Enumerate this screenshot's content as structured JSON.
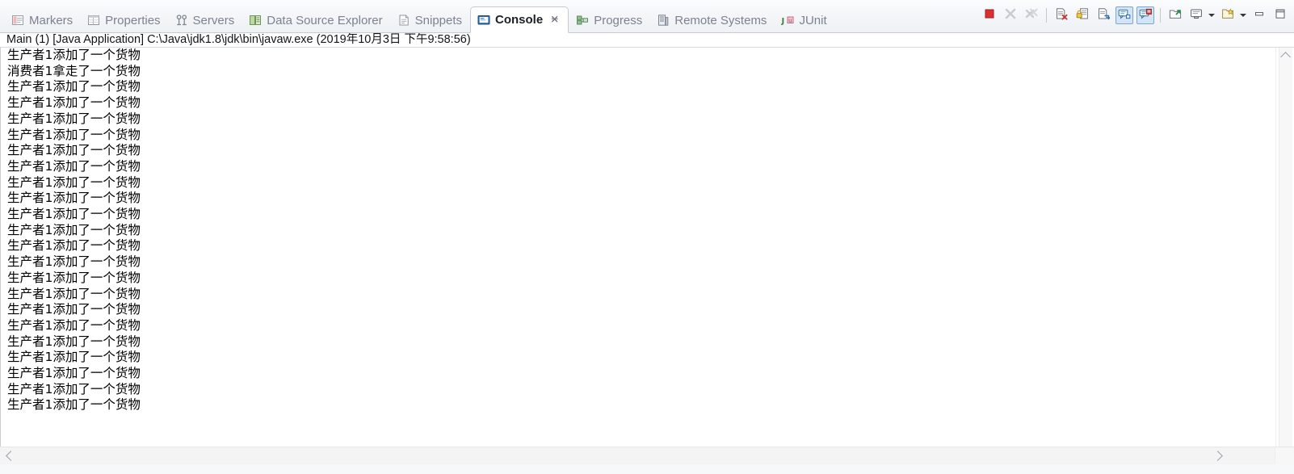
{
  "view": {
    "active_tab": "Console",
    "accent_color": "#d3e4f5",
    "toggled_border_color": "#7da7d0"
  },
  "tabs": [
    {
      "label": "Markers",
      "icon": "markers-icon",
      "active": false,
      "closable": false
    },
    {
      "label": "Properties",
      "icon": "properties-icon",
      "active": false,
      "closable": false
    },
    {
      "label": "Servers",
      "icon": "servers-icon",
      "active": false,
      "closable": false
    },
    {
      "label": "Data Source Explorer",
      "icon": "data-source-explorer-icon",
      "active": false,
      "closable": false
    },
    {
      "label": "Snippets",
      "icon": "snippets-icon",
      "active": false,
      "closable": false
    },
    {
      "label": "Console",
      "icon": "console-icon",
      "active": true,
      "closable": true
    },
    {
      "label": "Progress",
      "icon": "progress-icon",
      "active": false,
      "closable": false
    },
    {
      "label": "Remote Systems",
      "icon": "remote-systems-icon",
      "active": false,
      "closable": false
    },
    {
      "label": "JUnit",
      "icon": "junit-icon",
      "active": false,
      "closable": false
    }
  ],
  "toolbar": {
    "buttons": [
      {
        "name": "terminate-button",
        "icon": "stop-square-icon",
        "enabled": true,
        "toggled": false
      },
      {
        "name": "remove-launch-button",
        "icon": "remove-x-icon",
        "enabled": false,
        "toggled": false
      },
      {
        "name": "remove-all-terminated-button",
        "icon": "remove-all-x-icon",
        "enabled": false,
        "toggled": false
      },
      {
        "separator": true
      },
      {
        "name": "clear-console-button",
        "icon": "clear-console-icon",
        "enabled": true,
        "toggled": false
      },
      {
        "name": "scroll-lock-button",
        "icon": "scroll-lock-icon",
        "enabled": true,
        "toggled": false
      },
      {
        "name": "word-wrap-button",
        "icon": "word-wrap-icon",
        "enabled": true,
        "toggled": false
      },
      {
        "name": "show-console-on-output-button",
        "icon": "show-on-stdout-icon",
        "enabled": true,
        "toggled": true
      },
      {
        "name": "show-console-on-error-button",
        "icon": "show-on-stderr-icon",
        "enabled": true,
        "toggled": true
      },
      {
        "separator": true
      },
      {
        "name": "pin-console-button",
        "icon": "pin-console-icon",
        "enabled": true,
        "toggled": false
      },
      {
        "name": "display-selected-console-button",
        "icon": "display-console-icon",
        "enabled": true,
        "toggled": false
      },
      {
        "name": "display-console-dropdown",
        "icon": "chevron-down-icon",
        "enabled": true,
        "toggled": false,
        "is_arrow": true
      },
      {
        "name": "open-console-button",
        "icon": "new-console-icon",
        "enabled": true,
        "toggled": false
      },
      {
        "name": "open-console-dropdown",
        "icon": "chevron-down-icon",
        "enabled": true,
        "toggled": false,
        "is_arrow": true
      },
      {
        "name": "minimize-view-button",
        "icon": "minimize-icon",
        "enabled": true,
        "toggled": false
      },
      {
        "name": "maximize-view-button",
        "icon": "maximize-icon",
        "enabled": true,
        "toggled": false
      }
    ]
  },
  "process": {
    "header": "Main (1) [Java Application] C:\\Java\\jdk1.8\\jdk\\bin\\javaw.exe (2019年10月3日 下午9:58:56)"
  },
  "console": {
    "lines": [
      "生产者1添加了一个货物",
      "消费者1拿走了一个货物",
      "生产者1添加了一个货物",
      "生产者1添加了一个货物",
      "生产者1添加了一个货物",
      "生产者1添加了一个货物",
      "生产者1添加了一个货物",
      "生产者1添加了一个货物",
      "生产者1添加了一个货物",
      "生产者1添加了一个货物",
      "生产者1添加了一个货物",
      "生产者1添加了一个货物",
      "生产者1添加了一个货物",
      "生产者1添加了一个货物",
      "生产者1添加了一个货物",
      "生产者1添加了一个货物",
      "生产者1添加了一个货物",
      "生产者1添加了一个货物",
      "生产者1添加了一个货物",
      "生产者1添加了一个货物",
      "生产者1添加了一个货物",
      "生产者1添加了一个货物",
      "生产者1添加了一个货物"
    ]
  },
  "scrollbars": {
    "vertical": {
      "up_arrow": "chevron-up-icon",
      "down_arrow": "chevron-down-icon"
    },
    "horizontal": {
      "left_arrow": "chevron-left-icon",
      "right_arrow": "chevron-right-icon"
    }
  }
}
